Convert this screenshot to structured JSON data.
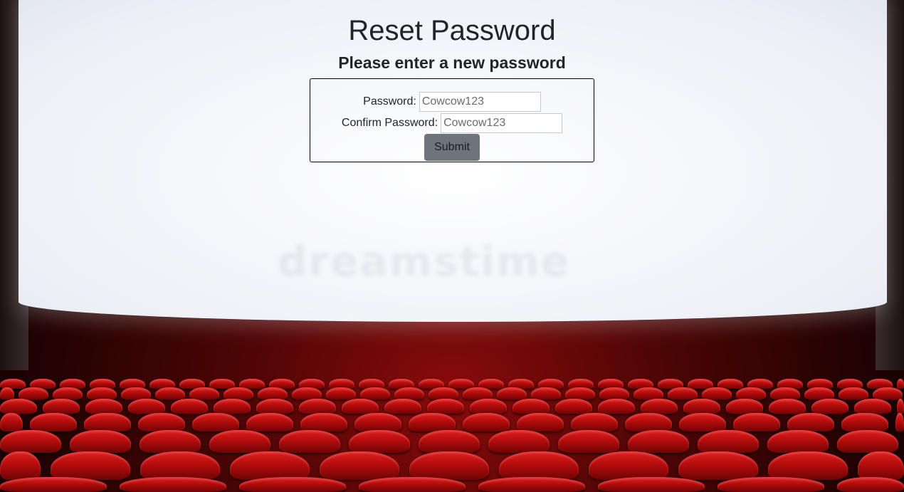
{
  "page": {
    "title": "Reset Password",
    "subtitle": "Please enter a new password"
  },
  "form": {
    "password_label": "Password:",
    "password_value": "Cowcow123",
    "confirm_label": "Confirm Password:",
    "confirm_value": "Cowcow123",
    "submit_label": "Submit"
  },
  "colors": {
    "submit_button": "#6c757d",
    "text": "#212529",
    "seat_red": "#c41414"
  }
}
